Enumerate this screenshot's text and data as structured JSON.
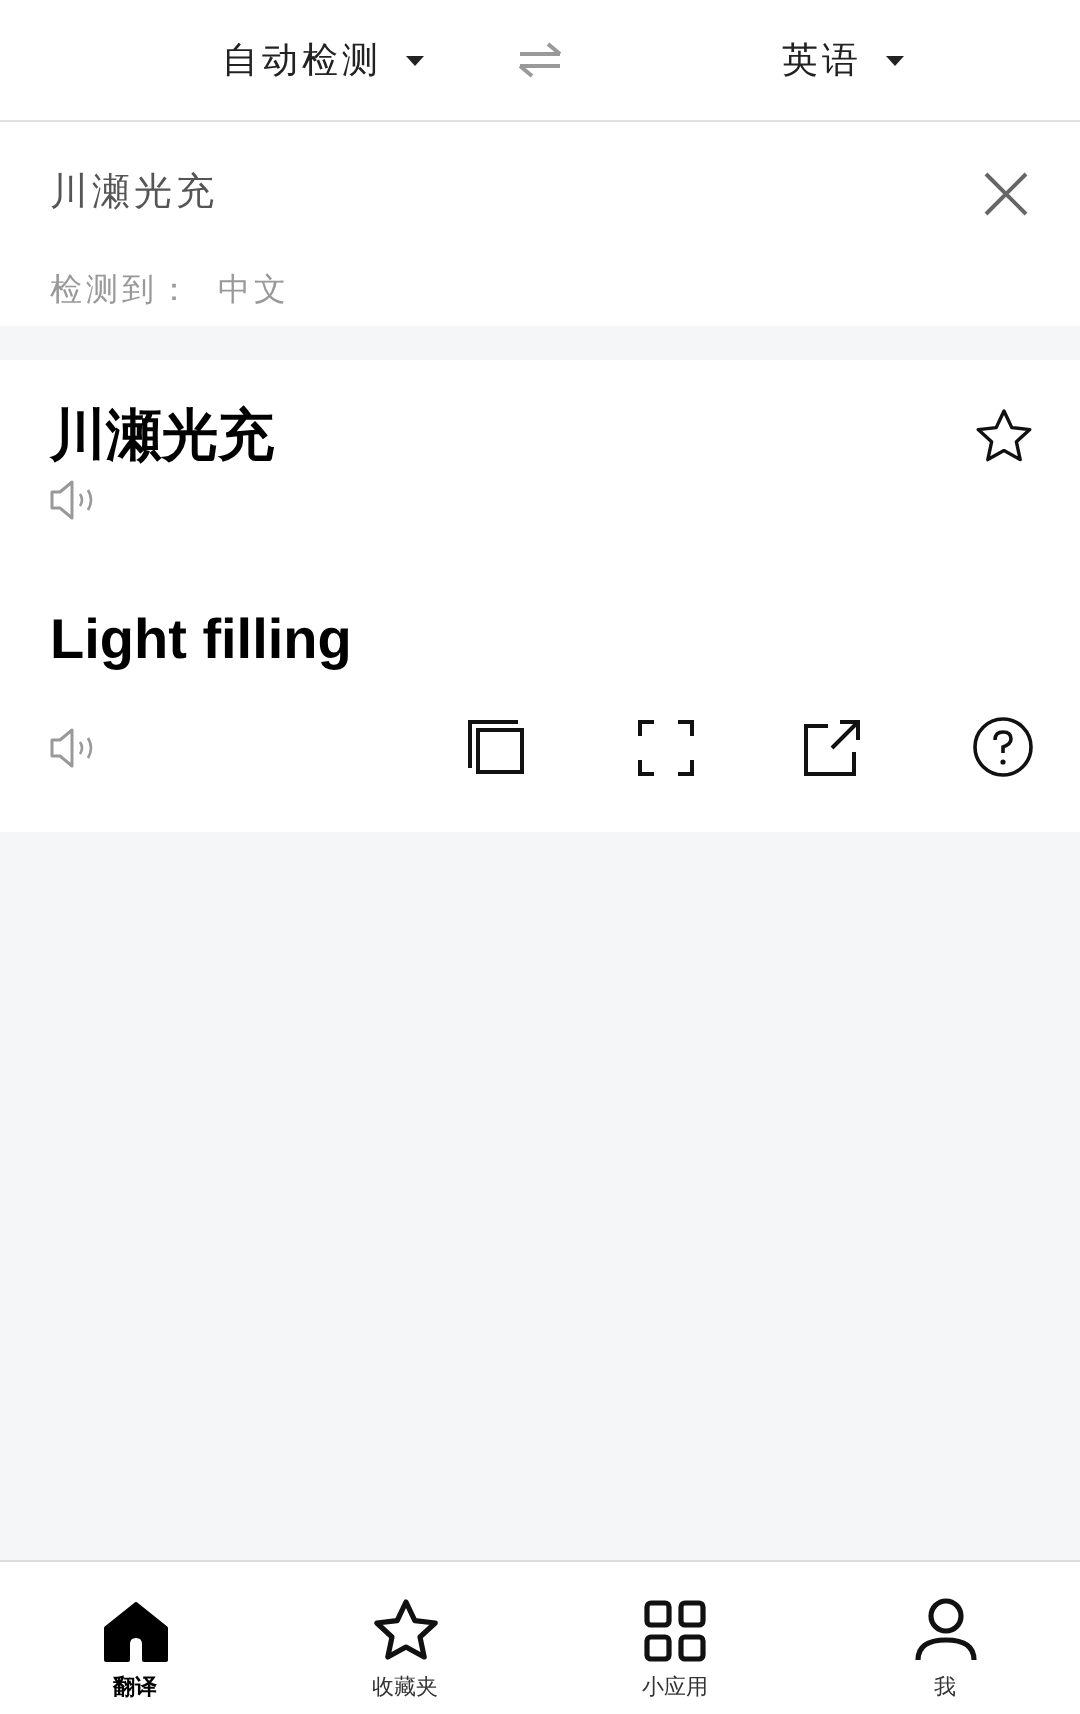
{
  "header": {
    "source_language": "自动检测",
    "target_language": "英语"
  },
  "input": {
    "value": "川瀬光充",
    "detected_label": "检测到：",
    "detected_language": "中文"
  },
  "result": {
    "source_text": "川瀬光充",
    "favorited": false,
    "translation": "Light filling"
  },
  "bottom_nav": [
    {
      "label": "翻译",
      "selected": true
    },
    {
      "label": "收藏夹",
      "selected": false
    },
    {
      "label": "小应用",
      "selected": false
    },
    {
      "label": "我",
      "selected": false
    }
  ]
}
